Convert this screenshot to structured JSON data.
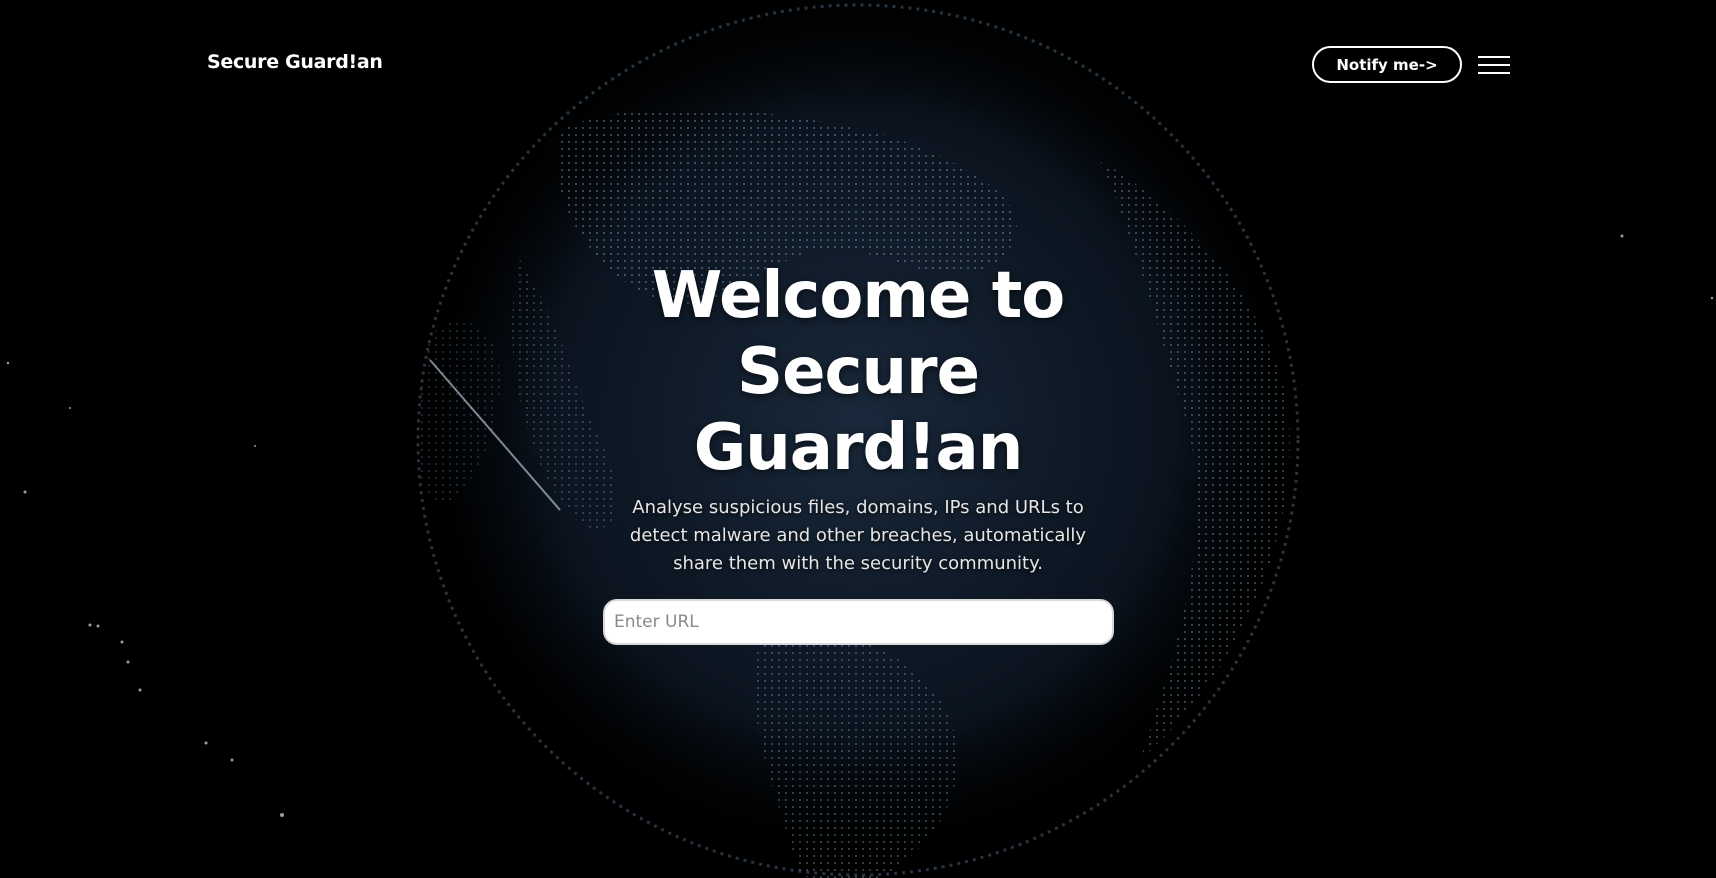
{
  "header": {
    "brand": "Secure Guard!an",
    "notify_label": "Notify me->",
    "menu_icon": "hamburger-menu-icon"
  },
  "hero": {
    "title_line1": "Welcome to",
    "title_line2": "Secure",
    "title_line3": "Guard!an",
    "subtitle": "Analyse suspicious files, domains, IPs and URLs to detect malware and other breaches, automatically share them with the security community."
  },
  "search": {
    "placeholder": "Enter URL",
    "value": ""
  },
  "background": {
    "image": "digital-globe-earth-dots",
    "accent": "#9fc4e8"
  }
}
